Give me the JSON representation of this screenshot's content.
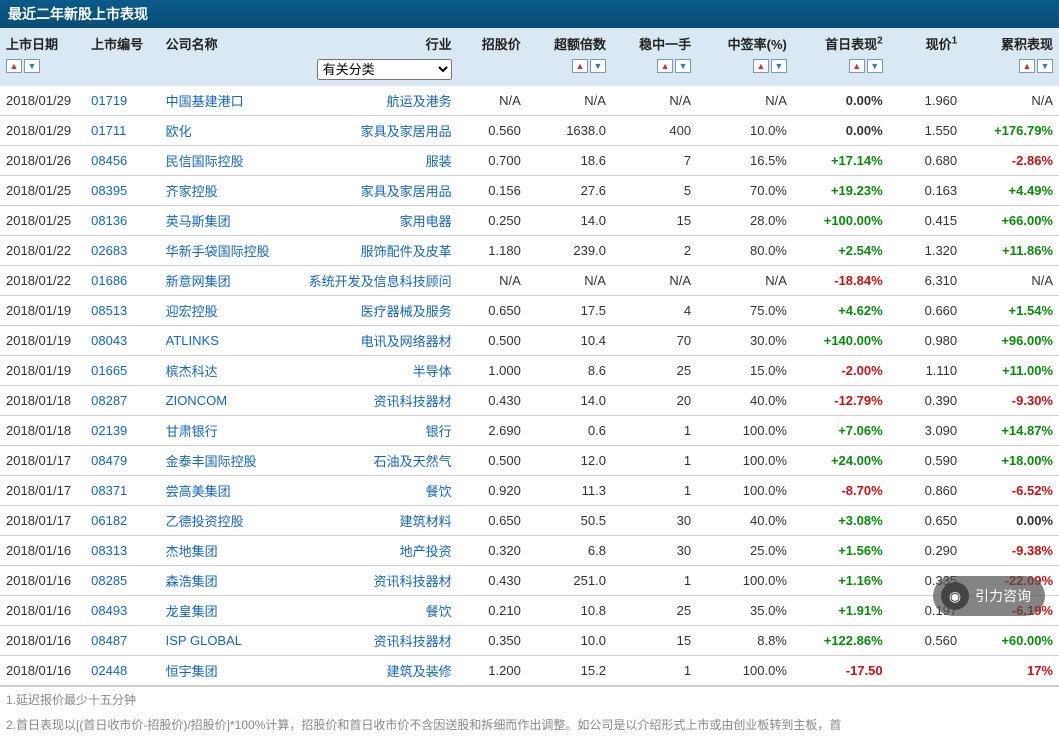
{
  "title": "最近二年新股上市表现",
  "filterLabel": "有关分类",
  "headers": {
    "date": "上市日期",
    "code": "上市编号",
    "name": "公司名称",
    "industry": "行业",
    "offerPrice": "招股价",
    "oversub": "超额倍数",
    "oneLot": "稳中一手",
    "winRate": "中签率(%)",
    "firstDay": "首日表现",
    "price": "现价",
    "cumulative": "累积表现",
    "sup1": "1",
    "sup2": "2"
  },
  "rows": [
    {
      "date": "2018/01/29",
      "code": "01719",
      "name": "中国基建港口",
      "industry": "航运及港务",
      "offerPrice": "N/A",
      "oversub": "N/A",
      "oneLot": "N/A",
      "winRate": "N/A",
      "firstDay": "0.00%",
      "firstDayCls": "zero",
      "price": "1.960",
      "cumulative": "N/A",
      "cumCls": ""
    },
    {
      "date": "2018/01/29",
      "code": "01711",
      "name": "欧化",
      "industry": "家具及家居用品",
      "offerPrice": "0.560",
      "oversub": "1638.0",
      "oneLot": "400",
      "winRate": "10.0%",
      "firstDay": "0.00%",
      "firstDayCls": "zero",
      "price": "1.550",
      "cumulative": "+176.79%",
      "cumCls": "pos"
    },
    {
      "date": "2018/01/26",
      "code": "08456",
      "name": "民信国际控股",
      "industry": "服装",
      "offerPrice": "0.700",
      "oversub": "18.6",
      "oneLot": "7",
      "winRate": "16.5%",
      "firstDay": "+17.14%",
      "firstDayCls": "pos",
      "price": "0.680",
      "cumulative": "-2.86%",
      "cumCls": "neg"
    },
    {
      "date": "2018/01/25",
      "code": "08395",
      "name": "齐家控股",
      "industry": "家具及家居用品",
      "offerPrice": "0.156",
      "oversub": "27.6",
      "oneLot": "5",
      "winRate": "70.0%",
      "firstDay": "+19.23%",
      "firstDayCls": "pos",
      "price": "0.163",
      "cumulative": "+4.49%",
      "cumCls": "pos"
    },
    {
      "date": "2018/01/25",
      "code": "08136",
      "name": "英马斯集团",
      "industry": "家用电器",
      "offerPrice": "0.250",
      "oversub": "14.0",
      "oneLot": "15",
      "winRate": "28.0%",
      "firstDay": "+100.00%",
      "firstDayCls": "pos",
      "price": "0.415",
      "cumulative": "+66.00%",
      "cumCls": "pos"
    },
    {
      "date": "2018/01/22",
      "code": "02683",
      "name": "华新手袋国际控股",
      "industry": "服饰配件及皮革",
      "offerPrice": "1.180",
      "oversub": "239.0",
      "oneLot": "2",
      "winRate": "80.0%",
      "firstDay": "+2.54%",
      "firstDayCls": "pos",
      "price": "1.320",
      "cumulative": "+11.86%",
      "cumCls": "pos"
    },
    {
      "date": "2018/01/22",
      "code": "01686",
      "name": "新意网集团",
      "industry": "系统开发及信息科技顾问",
      "offerPrice": "N/A",
      "oversub": "N/A",
      "oneLot": "N/A",
      "winRate": "N/A",
      "firstDay": "-18.84%",
      "firstDayCls": "neg",
      "price": "6.310",
      "cumulative": "N/A",
      "cumCls": ""
    },
    {
      "date": "2018/01/19",
      "code": "08513",
      "name": "迎宏控股",
      "industry": "医疗器械及服务",
      "offerPrice": "0.650",
      "oversub": "17.5",
      "oneLot": "4",
      "winRate": "75.0%",
      "firstDay": "+4.62%",
      "firstDayCls": "pos",
      "price": "0.660",
      "cumulative": "+1.54%",
      "cumCls": "pos"
    },
    {
      "date": "2018/01/19",
      "code": "08043",
      "name": "ATLINKS",
      "industry": "电讯及网络器材",
      "offerPrice": "0.500",
      "oversub": "10.4",
      "oneLot": "70",
      "winRate": "30.0%",
      "firstDay": "+140.00%",
      "firstDayCls": "pos",
      "price": "0.980",
      "cumulative": "+96.00%",
      "cumCls": "pos"
    },
    {
      "date": "2018/01/19",
      "code": "01665",
      "name": "槟杰科达",
      "industry": "半导体",
      "offerPrice": "1.000",
      "oversub": "8.6",
      "oneLot": "25",
      "winRate": "15.0%",
      "firstDay": "-2.00%",
      "firstDayCls": "neg",
      "price": "1.110",
      "cumulative": "+11.00%",
      "cumCls": "pos"
    },
    {
      "date": "2018/01/18",
      "code": "08287",
      "name": "ZIONCOM",
      "industry": "资讯科技器材",
      "offerPrice": "0.430",
      "oversub": "14.0",
      "oneLot": "20",
      "winRate": "40.0%",
      "firstDay": "-12.79%",
      "firstDayCls": "neg",
      "price": "0.390",
      "cumulative": "-9.30%",
      "cumCls": "neg"
    },
    {
      "date": "2018/01/18",
      "code": "02139",
      "name": "甘肃银行",
      "industry": "银行",
      "offerPrice": "2.690",
      "oversub": "0.6",
      "oneLot": "1",
      "winRate": "100.0%",
      "firstDay": "+7.06%",
      "firstDayCls": "pos",
      "price": "3.090",
      "cumulative": "+14.87%",
      "cumCls": "pos"
    },
    {
      "date": "2018/01/17",
      "code": "08479",
      "name": "金泰丰国际控股",
      "industry": "石油及天然气",
      "offerPrice": "0.500",
      "oversub": "12.0",
      "oneLot": "1",
      "winRate": "100.0%",
      "firstDay": "+24.00%",
      "firstDayCls": "pos",
      "price": "0.590",
      "cumulative": "+18.00%",
      "cumCls": "pos"
    },
    {
      "date": "2018/01/17",
      "code": "08371",
      "name": "尝高美集团",
      "industry": "餐饮",
      "offerPrice": "0.920",
      "oversub": "11.3",
      "oneLot": "1",
      "winRate": "100.0%",
      "firstDay": "-8.70%",
      "firstDayCls": "neg",
      "price": "0.860",
      "cumulative": "-6.52%",
      "cumCls": "neg"
    },
    {
      "date": "2018/01/17",
      "code": "06182",
      "name": "乙德投资控股",
      "industry": "建筑材料",
      "offerPrice": "0.650",
      "oversub": "50.5",
      "oneLot": "30",
      "winRate": "40.0%",
      "firstDay": "+3.08%",
      "firstDayCls": "pos",
      "price": "0.650",
      "cumulative": "0.00%",
      "cumCls": "zero"
    },
    {
      "date": "2018/01/16",
      "code": "08313",
      "name": "杰地集团",
      "industry": "地产投资",
      "offerPrice": "0.320",
      "oversub": "6.8",
      "oneLot": "30",
      "winRate": "25.0%",
      "firstDay": "+1.56%",
      "firstDayCls": "pos",
      "price": "0.290",
      "cumulative": "-9.38%",
      "cumCls": "neg"
    },
    {
      "date": "2018/01/16",
      "code": "08285",
      "name": "森浩集团",
      "industry": "资讯科技器材",
      "offerPrice": "0.430",
      "oversub": "251.0",
      "oneLot": "1",
      "winRate": "100.0%",
      "firstDay": "+1.16%",
      "firstDayCls": "pos",
      "price": "0.335",
      "cumulative": "-22.09%",
      "cumCls": "neg"
    },
    {
      "date": "2018/01/16",
      "code": "08493",
      "name": "龙皇集团",
      "industry": "餐饮",
      "offerPrice": "0.210",
      "oversub": "10.8",
      "oneLot": "25",
      "winRate": "35.0%",
      "firstDay": "+1.91%",
      "firstDayCls": "pos",
      "price": "0.197",
      "cumulative": "-6.19%",
      "cumCls": "neg"
    },
    {
      "date": "2018/01/16",
      "code": "08487",
      "name": "ISP GLOBAL",
      "industry": "资讯科技器材",
      "offerPrice": "0.350",
      "oversub": "10.0",
      "oneLot": "15",
      "winRate": "8.8%",
      "firstDay": "+122.86%",
      "firstDayCls": "pos",
      "price": "0.560",
      "cumulative": "+60.00%",
      "cumCls": "pos"
    },
    {
      "date": "2018/01/16",
      "code": "02448",
      "name": "恒宇集团",
      "industry": "建筑及装修",
      "offerPrice": "1.200",
      "oversub": "15.2",
      "oneLot": "1",
      "winRate": "100.0%",
      "firstDay": "-17.50",
      "firstDayCls": "neg",
      "price": "",
      "cumulative": "17%",
      "cumCls": "neg"
    }
  ],
  "footnote1": "1.延迟报价最少十五分钟",
  "footnote2": "2.首日表现以[(首日收市价-招股价)/招股价]*100%计算，招股价和首日收市价不含因送股和拆细而作出调整。如公司是以介绍形式上市或由创业板转到主板，首",
  "watermark": "引力咨询"
}
